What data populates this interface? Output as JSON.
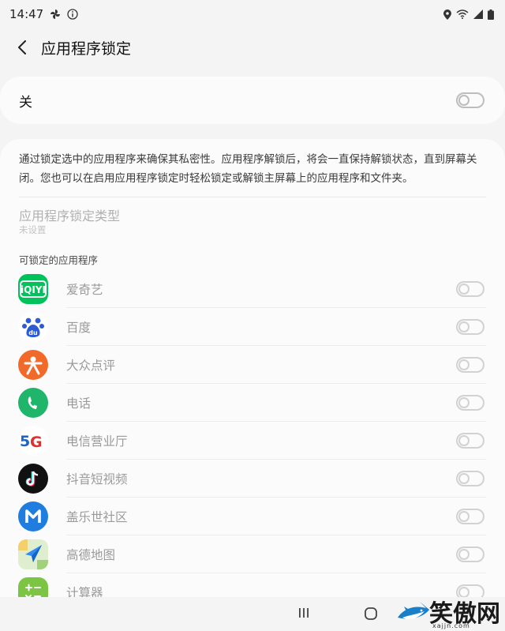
{
  "status_bar": {
    "time": "14:47"
  },
  "header": {
    "title": "应用程序锁定"
  },
  "master_switch": {
    "label": "关"
  },
  "description": "通过锁定选中的应用程序来确保其私密性。应用程序解锁后，将会一直保持解锁状态，直到屏幕关闭。您也可以在启用应用程序锁定时轻松锁定或解锁主屏幕上的应用程序和文件夹。",
  "lock_type": {
    "title": "应用程序锁定类型",
    "value": "未设置"
  },
  "apps_section_label": "可锁定的应用程序",
  "apps": [
    {
      "name": "爱奇艺",
      "icon": "iqiyi-icon",
      "color": "#00c25a"
    },
    {
      "name": "百度",
      "icon": "baidu-icon",
      "color": "#2d5bd6"
    },
    {
      "name": "大众点评",
      "icon": "dianping-icon",
      "color": "#f26a2a"
    },
    {
      "name": "电话",
      "icon": "phone-icon",
      "color": "#1fb56b"
    },
    {
      "name": "电信营业厅",
      "icon": "telecom-5g-icon",
      "color": "#1a66c8"
    },
    {
      "name": "抖音短视频",
      "icon": "douyin-icon",
      "color": "#111111"
    },
    {
      "name": "盖乐世社区",
      "icon": "galaxy-members-icon",
      "color": "#1f7de0"
    },
    {
      "name": "高德地图",
      "icon": "amap-icon",
      "color": "#2f8cf0"
    },
    {
      "name": "计算器",
      "icon": "calculator-icon",
      "color": "#7cc444"
    }
  ],
  "watermark": {
    "text": "笑傲网",
    "sub": "xajjn.com"
  }
}
